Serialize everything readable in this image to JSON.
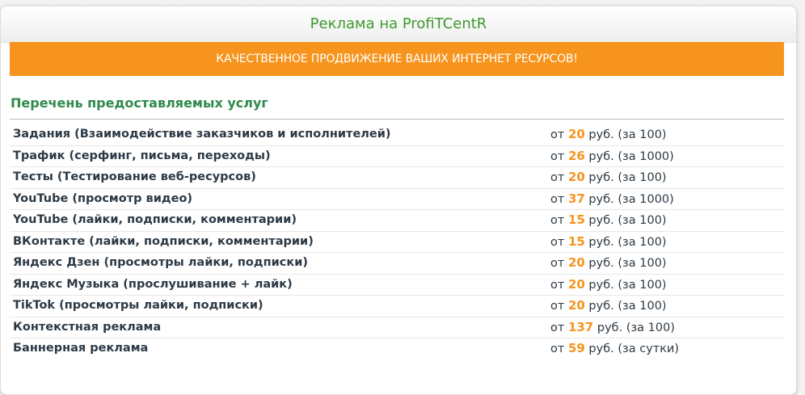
{
  "header": {
    "title": "Реклама на ProfiTCentR"
  },
  "promo": {
    "text": "КАЧЕСТВЕННОЕ ПРОДВИЖЕНИЕ ВАШИХ ИНТЕРНЕТ РЕСУРСОВ!"
  },
  "services": {
    "title": "Перечень предоставляемых услуг",
    "price_prefix": "от",
    "currency": "руб.",
    "items": [
      {
        "name": "Задания (Взаимодействие заказчиков и исполнителей)",
        "price": "20",
        "unit": "(за 100)"
      },
      {
        "name": "Трафик (серфинг, письма, переходы)",
        "price": "26",
        "unit": "(за 1000)"
      },
      {
        "name": "Тесты (Тестирование веб-ресурсов)",
        "price": "20",
        "unit": "(за 100)"
      },
      {
        "name": "YouTube (просмотр видео)",
        "price": "37",
        "unit": "(за 1000)"
      },
      {
        "name": "YouTube (лайки, подписки, комментарии)",
        "price": "15",
        "unit": "(за 100)"
      },
      {
        "name": "ВКонтакте (лайки, подписки, комментарии)",
        "price": "15",
        "unit": "(за 100)"
      },
      {
        "name": "Яндекс Дзен (просмотры лайки, подписки)",
        "price": "20",
        "unit": "(за 100)"
      },
      {
        "name": "Яндекс Музыка (прослушивание + лайк)",
        "price": "20",
        "unit": "(за 100)"
      },
      {
        "name": "TikTok (просмотры лайки, подписки)",
        "price": "20",
        "unit": "(за 100)"
      },
      {
        "name": "Контекстная реклама",
        "price": "137",
        "unit": "(за 100)"
      },
      {
        "name": "Баннерная реклама",
        "price": "59",
        "unit": "(за сутки)"
      }
    ]
  },
  "colors": {
    "accent_orange": "#f7941d",
    "title_green": "#3c9a2c",
    "section_green": "#2e8a4a",
    "text_dark": "#2d3a45"
  }
}
